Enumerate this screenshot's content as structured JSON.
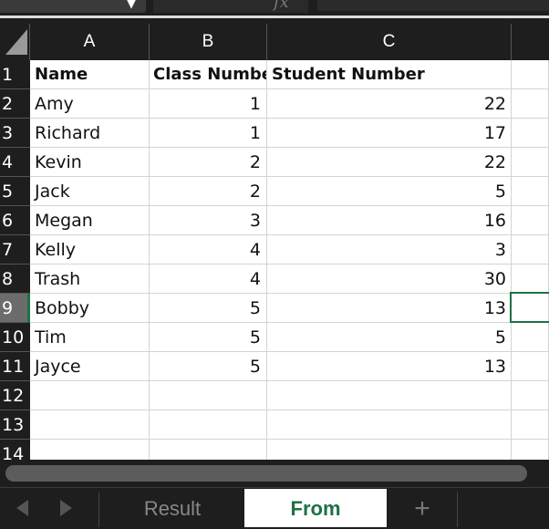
{
  "formula_bar": {
    "namebox_arrow": "▼",
    "fx_icon": "fx"
  },
  "sheet": {
    "columns": [
      "A",
      "B",
      "C"
    ],
    "row_numbers": [
      "1",
      "2",
      "3",
      "4",
      "5",
      "6",
      "7",
      "8",
      "9",
      "10",
      "11",
      "12",
      "13",
      "14"
    ],
    "rows": [
      {
        "a": "Name",
        "b": "Class Number",
        "c": "Student Number"
      },
      {
        "a": "Amy",
        "b": "1",
        "c": "22"
      },
      {
        "a": "Richard",
        "b": "1",
        "c": "17"
      },
      {
        "a": "Kevin",
        "b": "2",
        "c": "22"
      },
      {
        "a": "Jack",
        "b": "2",
        "c": "5"
      },
      {
        "a": "Megan",
        "b": "3",
        "c": "16"
      },
      {
        "a": "Kelly",
        "b": "4",
        "c": "3"
      },
      {
        "a": "Trash",
        "b": "4",
        "c": "30"
      },
      {
        "a": "Bobby",
        "b": "5",
        "c": "13"
      },
      {
        "a": "Tim",
        "b": "5",
        "c": "5"
      },
      {
        "a": "Jayce",
        "b": "5",
        "c": "13"
      }
    ],
    "selected_row": "9",
    "accent_color": "#1e7145"
  },
  "tabs": {
    "items": [
      {
        "label": "Result",
        "active": false
      },
      {
        "label": "From",
        "active": true
      }
    ],
    "add_label": "+"
  }
}
